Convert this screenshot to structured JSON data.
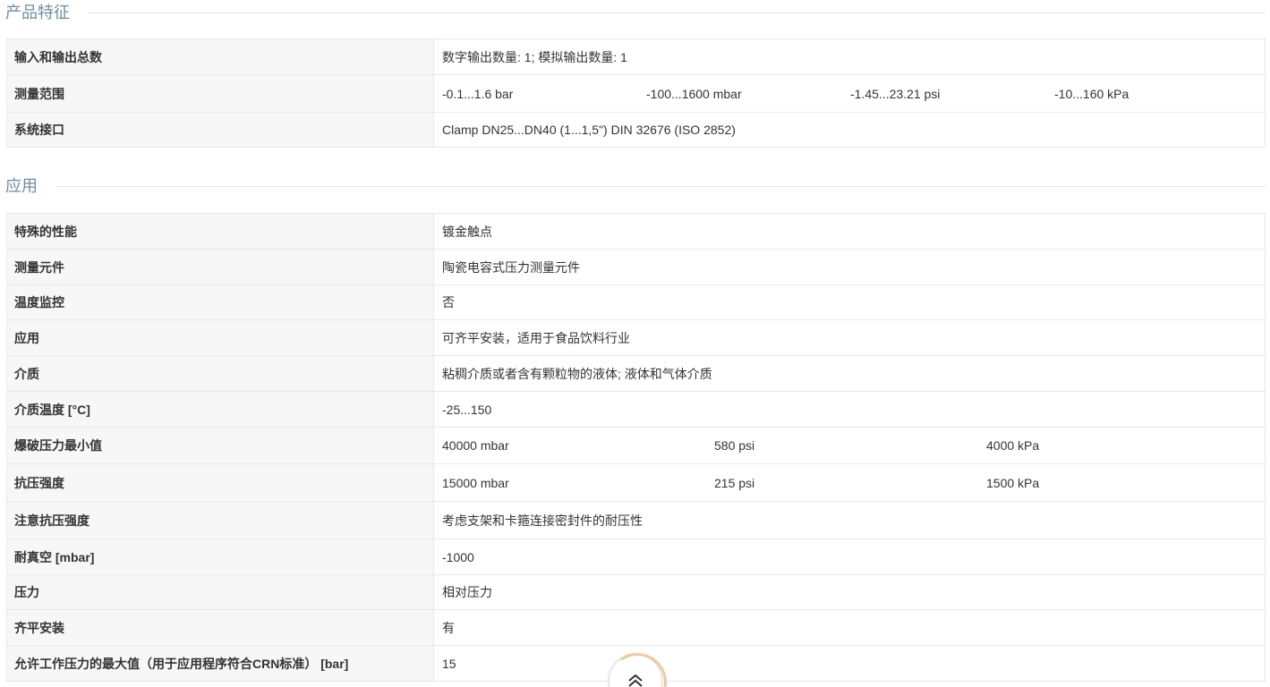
{
  "sections": {
    "features": {
      "title": "产品特征",
      "rows": [
        {
          "label": "输入和输出总数",
          "value": "数字输出数量: 1; 模拟输出数量: 1"
        },
        {
          "label": "测量范围",
          "values": [
            "-0.1...1.6 bar",
            "-100...1600 mbar",
            "-1.45...23.21 psi",
            "-10...160 kPa"
          ]
        },
        {
          "label": "系统接口",
          "value": "Clamp DN25...DN40 (1...1,5\") DIN 32676 (ISO 2852)"
        }
      ]
    },
    "application": {
      "title": "应用",
      "rows": [
        {
          "label": "特殊的性能",
          "value": "镀金触点"
        },
        {
          "label": "测量元件",
          "value": "陶瓷电容式压力测量元件"
        },
        {
          "label": "温度监控",
          "value": "否"
        },
        {
          "label": "应用",
          "value": "可齐平安装，适用于食品饮料行业"
        },
        {
          "label": "介质",
          "value": "粘稠介质或者含有颗粒物的液体; 液体和气体介质"
        },
        {
          "label": "介质温度 [°C]",
          "value": "-25...150"
        },
        {
          "label": "爆破压力最小值",
          "values": [
            "40000 mbar",
            "580 psi",
            "4000 kPa"
          ]
        },
        {
          "label": "抗压强度",
          "values": [
            "15000 mbar",
            "215 psi",
            "1500 kPa"
          ]
        },
        {
          "label": "注意抗压强度",
          "value": "考虑支架和卡箍连接密封件的耐压性"
        },
        {
          "label": "耐真空 [mbar]",
          "value": "-1000"
        },
        {
          "label": "压力",
          "value": "相对压力"
        },
        {
          "label": "齐平安装",
          "value": "有"
        },
        {
          "label": "允许工作压力的最大值（用于应用程序符合CRN标准） [bar]",
          "value": "15"
        }
      ]
    }
  },
  "icons": {
    "scroll_top": "double-chevron-up-icon"
  }
}
